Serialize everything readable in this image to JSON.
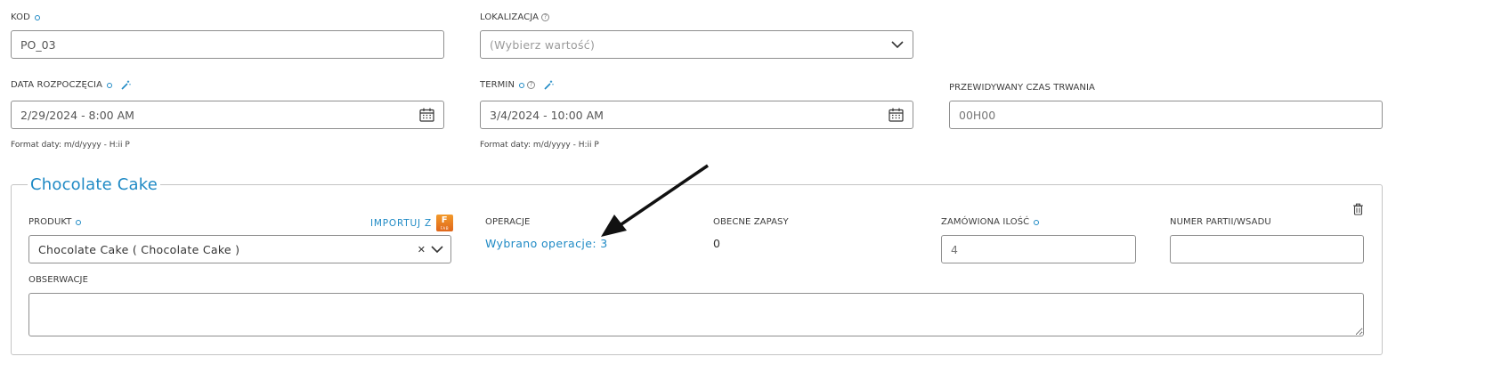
{
  "row1": {
    "kod": {
      "label": "KOD",
      "value": "PO_03"
    },
    "lokalizacja": {
      "label": "LOKALIZACJA",
      "placeholder": "(Wybierz wartość)"
    }
  },
  "row2": {
    "start": {
      "label": "DATA ROZPOCZĘCIA",
      "value": "2/29/2024 - 8:00 AM",
      "hint": "Format daty: m/d/yyyy - H:ii P"
    },
    "termin": {
      "label": "TERMIN",
      "value": "3/4/2024 - 10:00 AM",
      "hint": "Format daty: m/d/yyyy - H:ii P"
    },
    "duration": {
      "label": "PRZEWIDYWANY CZAS TRWANIA",
      "value": "00H00"
    }
  },
  "product_section": {
    "title": "Chocolate Cake",
    "produkt": {
      "label": "PRODUKT",
      "value": "Chocolate Cake ( Chocolate Cake )"
    },
    "import": {
      "label": "IMPORTUJ Z",
      "logo_letter": "F",
      "logo_caption": "FAB"
    },
    "operacje": {
      "label": "OPERACJE",
      "link": "Wybrano operacje: 3"
    },
    "zapasy": {
      "label": "OBECNE ZAPASY",
      "value": "0"
    },
    "ilosc": {
      "label": "ZAMÓWIONA ILOŚĆ",
      "value": "4"
    },
    "partia": {
      "label": "NUMER PARTII/WSADU",
      "value": ""
    },
    "obserwacje": {
      "label": "OBSERWACJE",
      "value": ""
    }
  },
  "icons": [
    "required-dot-icon",
    "help-icon",
    "magic-wand-icon",
    "calendar-icon",
    "chevron-down-icon",
    "clear-icon",
    "trash-icon",
    "arrow-annotation"
  ],
  "colors": {
    "accent": "#1f8ac5",
    "border": "#8f8f8f",
    "logo": "#e97a22"
  }
}
